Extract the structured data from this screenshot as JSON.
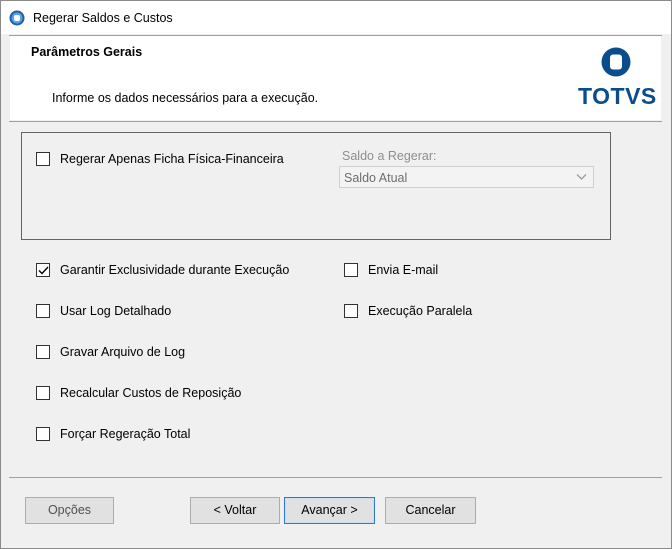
{
  "window": {
    "title": "Regerar Saldos e Custos"
  },
  "header": {
    "title": "Parâmetros Gerais",
    "subtitle": "Informe os dados necessários para a execução.",
    "logo_text": "TOTVS"
  },
  "group": {
    "checkbox_label": "Regerar Apenas Ficha Física-Financeira",
    "checkbox_checked": false,
    "saldo_label": "Saldo a Regerar:",
    "saldo_value": "Saldo Atual"
  },
  "options": {
    "left": [
      {
        "label": "Garantir Exclusividade durante Execução",
        "checked": true
      },
      {
        "label": "Usar Log Detalhado",
        "checked": false
      },
      {
        "label": "Gravar Arquivo de Log",
        "checked": false
      },
      {
        "label": "Recalcular Custos de Reposição",
        "checked": false
      },
      {
        "label": "Forçar Regeração Total",
        "checked": false
      }
    ],
    "right": [
      {
        "label": "Envia E-mail",
        "checked": false
      },
      {
        "label": "Execução Paralela",
        "checked": false
      }
    ]
  },
  "buttons": {
    "options": "Opções",
    "back": "< Voltar",
    "next": "Avançar >",
    "cancel": "Cancelar"
  },
  "colors": {
    "logo_blue": "#0b4d8c",
    "focus_border": "#2b7ad4"
  }
}
